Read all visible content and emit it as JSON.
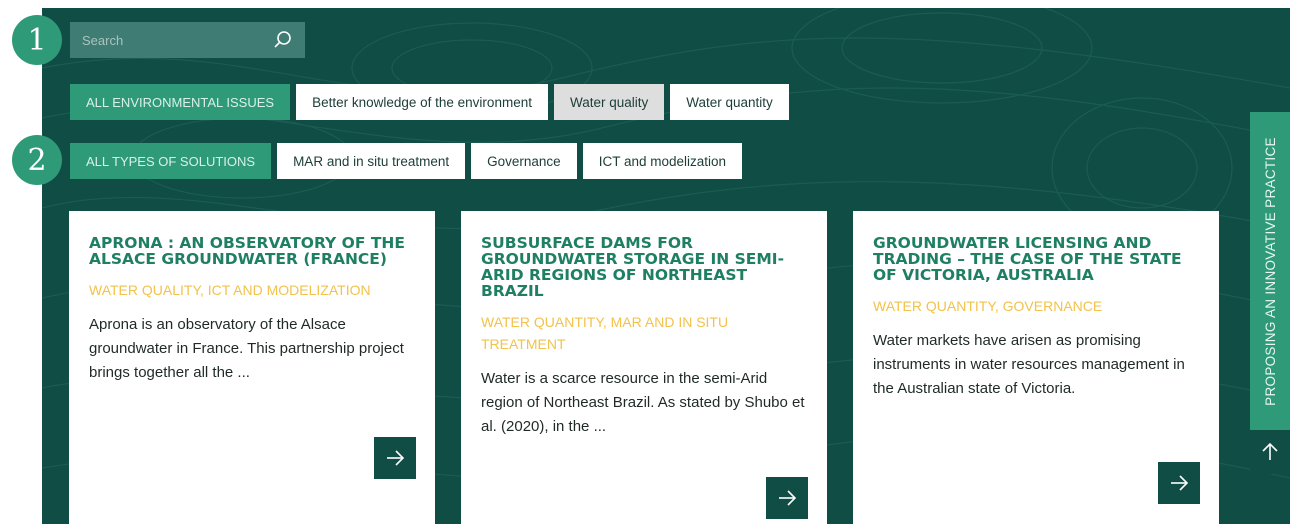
{
  "markers": [
    "1",
    "2"
  ],
  "search": {
    "placeholder": "Search",
    "icon": "search-icon"
  },
  "issue_filters": [
    {
      "label": "ALL ENVIRONMENTAL ISSUES",
      "state": "active"
    },
    {
      "label": "Better knowledge of the environment",
      "state": "default"
    },
    {
      "label": "Water quality",
      "state": "selected"
    },
    {
      "label": "Water quantity",
      "state": "default"
    }
  ],
  "solution_filters": [
    {
      "label": "ALL TYPES OF SOLUTIONS",
      "state": "active"
    },
    {
      "label": "MAR and in situ treatment",
      "state": "default"
    },
    {
      "label": "Governance",
      "state": "default"
    },
    {
      "label": "ICT and modelization",
      "state": "default"
    }
  ],
  "cards": [
    {
      "title": "APRONA : AN OBSERVATORY OF THE ALSACE GROUNDWATER (FRANCE)",
      "tags": "WATER QUALITY, ICT AND MODELIZATION",
      "text": "Aprona is an observatory of the Alsace groundwater in France. This partnership project brings together all the ..."
    },
    {
      "title": "SUBSURFACE DAMS FOR GROUNDWATER STORAGE IN SEMI-ARID REGIONS OF NORTHEAST BRAZIL",
      "tags": "WATER QUANTITY, MAR AND IN SITU TREATMENT",
      "text": "Water is a scarce resource in the semi-Arid region of Northeast Brazil. As stated by Shubo et al. (2020), in the ..."
    },
    {
      "title": "GROUNDWATER LICENSING AND TRADING – THE CASE OF THE STATE OF VICTORIA, AUSTRALIA",
      "tags": "WATER QUANTITY, GOVERNANCE",
      "text": "Water markets have arisen as promising instruments in water resources management in the Australian state of Victoria."
    }
  ],
  "side_tab": {
    "label": "PROPOSING AN INNOVATIVE PRACTICE"
  },
  "colors": {
    "panel_bg": "#0f4d45",
    "accent_green": "#2e9a78",
    "title_green": "#1f7f63",
    "tag_yellow": "#f2c24b"
  }
}
